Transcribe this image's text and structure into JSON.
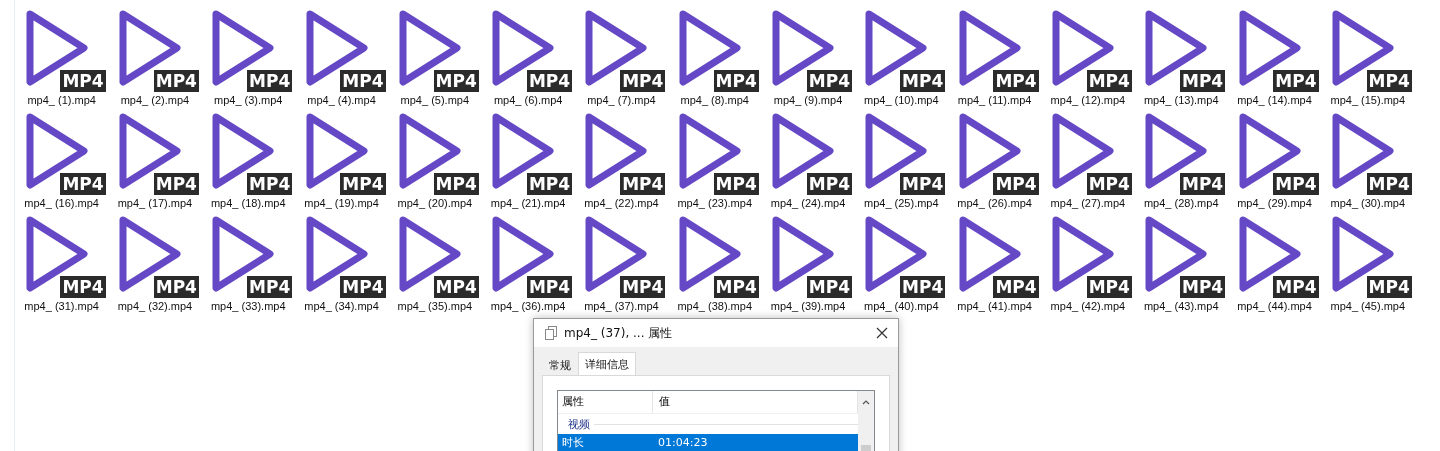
{
  "files": [
    {
      "name": "mp4_ (1).mp4",
      "badge": "MP4"
    },
    {
      "name": "mp4_ (2).mp4",
      "badge": "MP4"
    },
    {
      "name": "mp4_ (3).mp4",
      "badge": "MP4"
    },
    {
      "name": "mp4_ (4).mp4",
      "badge": "MP4"
    },
    {
      "name": "mp4_ (5).mp4",
      "badge": "MP4"
    },
    {
      "name": "mp4_ (6).mp4",
      "badge": "MP4"
    },
    {
      "name": "mp4_ (7).mp4",
      "badge": "MP4"
    },
    {
      "name": "mp4_ (8).mp4",
      "badge": "MP4"
    },
    {
      "name": "mp4_ (9).mp4",
      "badge": "MP4"
    },
    {
      "name": "mp4_ (10).mp4",
      "badge": "MP4"
    },
    {
      "name": "mp4_ (11).mp4",
      "badge": "MP4"
    },
    {
      "name": "mp4_ (12).mp4",
      "badge": "MP4"
    },
    {
      "name": "mp4_ (13).mp4",
      "badge": "MP4"
    },
    {
      "name": "mp4_ (14).mp4",
      "badge": "MP4"
    },
    {
      "name": "mp4_ (15).mp4",
      "badge": "MP4"
    },
    {
      "name": "mp4_ (16).mp4",
      "badge": "MP4"
    },
    {
      "name": "mp4_ (17).mp4",
      "badge": "MP4"
    },
    {
      "name": "mp4_ (18).mp4",
      "badge": "MP4"
    },
    {
      "name": "mp4_ (19).mp4",
      "badge": "MP4"
    },
    {
      "name": "mp4_ (20).mp4",
      "badge": "MP4"
    },
    {
      "name": "mp4_ (21).mp4",
      "badge": "MP4"
    },
    {
      "name": "mp4_ (22).mp4",
      "badge": "MP4"
    },
    {
      "name": "mp4_ (23).mp4",
      "badge": "MP4"
    },
    {
      "name": "mp4_ (24).mp4",
      "badge": "MP4"
    },
    {
      "name": "mp4_ (25).mp4",
      "badge": "MP4"
    },
    {
      "name": "mp4_ (26).mp4",
      "badge": "MP4"
    },
    {
      "name": "mp4_ (27).mp4",
      "badge": "MP4"
    },
    {
      "name": "mp4_ (28).mp4",
      "badge": "MP4"
    },
    {
      "name": "mp4_ (29).mp4",
      "badge": "MP4"
    },
    {
      "name": "mp4_ (30).mp4",
      "badge": "MP4"
    },
    {
      "name": "mp4_ (31).mp4",
      "badge": "MP4"
    },
    {
      "name": "mp4_ (32).mp4",
      "badge": "MP4"
    },
    {
      "name": "mp4_ (33).mp4",
      "badge": "MP4"
    },
    {
      "name": "mp4_ (34).mp4",
      "badge": "MP4"
    },
    {
      "name": "mp4_ (35).mp4",
      "badge": "MP4"
    },
    {
      "name": "mp4_ (36).mp4",
      "badge": "MP4"
    },
    {
      "name": "mp4_ (37).mp4",
      "badge": "MP4"
    },
    {
      "name": "mp4_ (38).mp4",
      "badge": "MP4"
    },
    {
      "name": "mp4_ (39).mp4",
      "badge": "MP4"
    },
    {
      "name": "mp4_ (40).mp4",
      "badge": "MP4"
    },
    {
      "name": "mp4_ (41).mp4",
      "badge": "MP4"
    },
    {
      "name": "mp4_ (42).mp4",
      "badge": "MP4"
    },
    {
      "name": "mp4_ (43).mp4",
      "badge": "MP4"
    },
    {
      "name": "mp4_ (44).mp4",
      "badge": "MP4"
    },
    {
      "name": "mp4_ (45).mp4",
      "badge": "MP4"
    }
  ],
  "dialog": {
    "title": "mp4_ (37), ... 属性",
    "tabs": [
      {
        "label": "常规",
        "selected": false
      },
      {
        "label": "详细信息",
        "selected": true
      }
    ],
    "columns": [
      "属性",
      "值"
    ],
    "group": "视频",
    "rows": [
      {
        "property": "时长",
        "value": "01:04:23",
        "selected": true
      }
    ]
  }
}
